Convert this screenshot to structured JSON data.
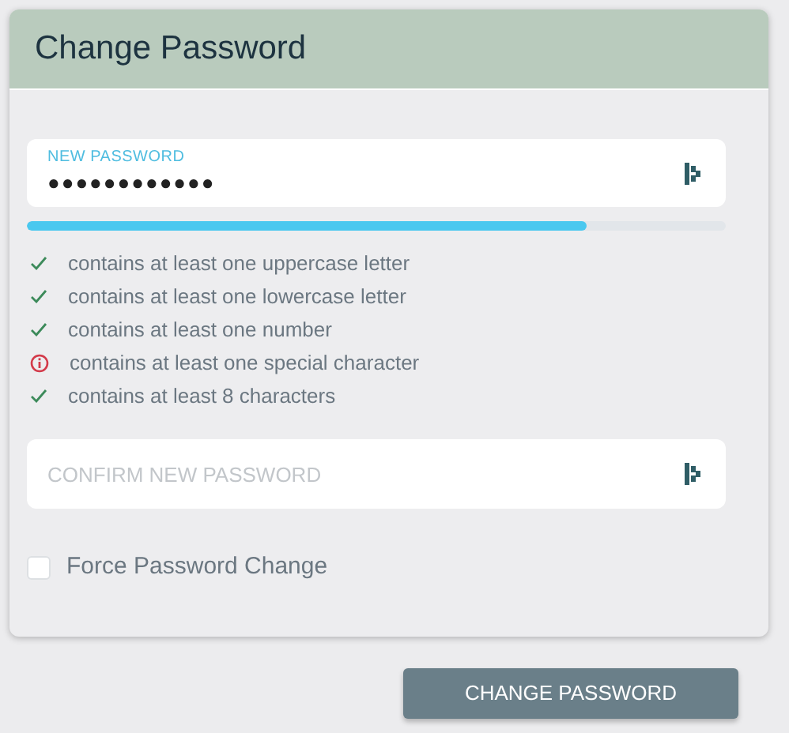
{
  "dialog": {
    "title": "Change Password"
  },
  "new_password": {
    "label": "NEW PASSWORD",
    "value": "●●●●●●●●●●●●"
  },
  "strength": {
    "level": 0.8
  },
  "rules": [
    {
      "text": "contains at least one uppercase letter",
      "met": true
    },
    {
      "text": "contains at least one lowercase letter",
      "met": true
    },
    {
      "text": "contains at least one number",
      "met": true
    },
    {
      "text": "contains at least one special character",
      "met": false
    },
    {
      "text": "contains at least 8 characters",
      "met": true
    }
  ],
  "confirm_password": {
    "placeholder": "CONFIRM NEW PASSWORD"
  },
  "force_change": {
    "label": "Force Password Change",
    "checked": false
  },
  "submit": {
    "label": "CHANGE PASSWORD"
  }
}
